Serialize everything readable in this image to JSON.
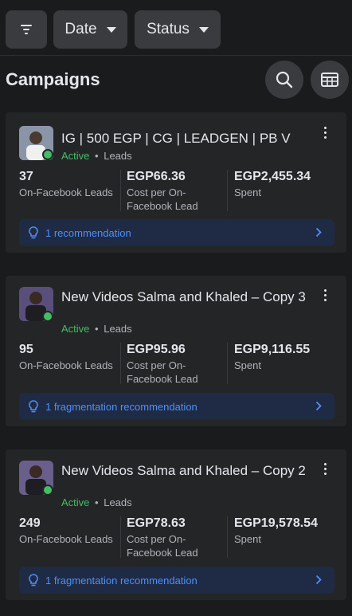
{
  "filters": {
    "filter_icon": "filter-lines-icon",
    "date_label": "Date",
    "status_label": "Status"
  },
  "header": {
    "title": "Campaigns",
    "search_icon": "search-icon",
    "table_icon": "table-view-icon"
  },
  "colors": {
    "active": "#45bd62",
    "link": "#4f8ff7",
    "card_bg": "#242527",
    "rec_bg": "#1f2b44"
  },
  "campaigns": [
    {
      "name": "IG | 500 EGP | CG | LEADGEN | PB V",
      "status": "Active",
      "separator": "•",
      "objective": "Leads",
      "metrics": [
        {
          "value": "37",
          "label": "On-Facebook Leads"
        },
        {
          "value": "EGP66.36",
          "label": "Cost per On-Facebook Lead"
        },
        {
          "value": "EGP2,455.34",
          "label": "Spent"
        }
      ],
      "recommendation": "1 recommendation"
    },
    {
      "name": "New Videos Salma and Khaled – Copy 3",
      "status": "Active",
      "separator": "•",
      "objective": "Leads",
      "metrics": [
        {
          "value": "95",
          "label": "On-Facebook Leads"
        },
        {
          "value": "EGP95.96",
          "label": "Cost per On-Facebook Lead"
        },
        {
          "value": "EGP9,116.55",
          "label": "Spent"
        }
      ],
      "recommendation": "1 fragmentation recommendation"
    },
    {
      "name": "New Videos Salma and Khaled – Copy 2",
      "status": "Active",
      "separator": "•",
      "objective": "Leads",
      "metrics": [
        {
          "value": "249",
          "label": "On-Facebook Leads"
        },
        {
          "value": "EGP78.63",
          "label": "Cost per On-Facebook Lead"
        },
        {
          "value": "EGP19,578.54",
          "label": "Spent"
        }
      ],
      "recommendation": "1 fragmentation recommendation"
    }
  ]
}
